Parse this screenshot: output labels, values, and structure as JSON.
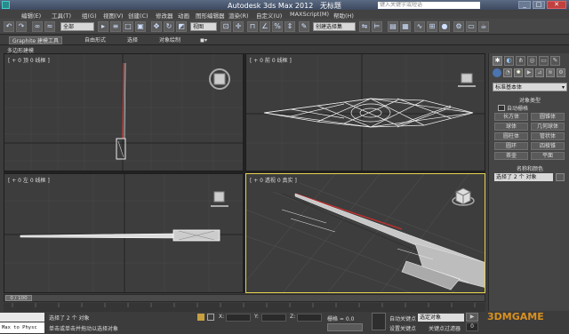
{
  "title": {
    "app": "Autodesk 3ds Max  2012",
    "file": "无标题",
    "search_placeholder": "键入关键字或短语"
  },
  "menu": [
    "编辑(E)",
    "工具(T)",
    "组(G)",
    "视图(V)",
    "创建(C)",
    "修改器",
    "动画",
    "图形编辑器",
    "渲染(R)",
    "自定义(U)",
    "MAXScript(M)",
    "帮助(H)"
  ],
  "toolbar": {
    "selection_filter": "全部",
    "ref_coord": "视图",
    "named_set": "创建选择集"
  },
  "ribbon": {
    "tabs": [
      "Graphite 建模工具",
      "自由形式",
      "选择",
      "对象绘制"
    ],
    "sub": "多边形建模"
  },
  "viewports": {
    "top": "[ + 0 顶 0 线框 ]",
    "front": "[ + 0 前 0 线框 ]",
    "left": "[ + 0 左 0 线框 ]",
    "persp": "[ + 0 透视 0 真实 ]"
  },
  "command_panel": {
    "category": "标准基本体",
    "object_type_header": "对象类型",
    "autogrid": "自动栅格",
    "buttons": [
      "长方体",
      "圆锥体",
      "球体",
      "几何球体",
      "圆柱体",
      "管状体",
      "圆环",
      "四棱锥",
      "茶壶",
      "平面"
    ],
    "name_color_header": "名称和颜色",
    "name_value": "选择了 2 个 对象"
  },
  "timeline": {
    "frame": "0 / 100"
  },
  "status": {
    "selection": "选择了 2 个 对象",
    "prompt": "单击或单击并拖动以选择对象",
    "maxscript": "Max to Physc",
    "grid": "栅格 = 0.0",
    "autokey": "自动关键点",
    "selected": "选定对象",
    "setkey": "设置关键点",
    "keyfilter": "关键点过滤器",
    "frame_value": "0",
    "x_label": "X:",
    "y_label": "Y:",
    "z_label": "Z:"
  },
  "watermark": "3DMGAME"
}
